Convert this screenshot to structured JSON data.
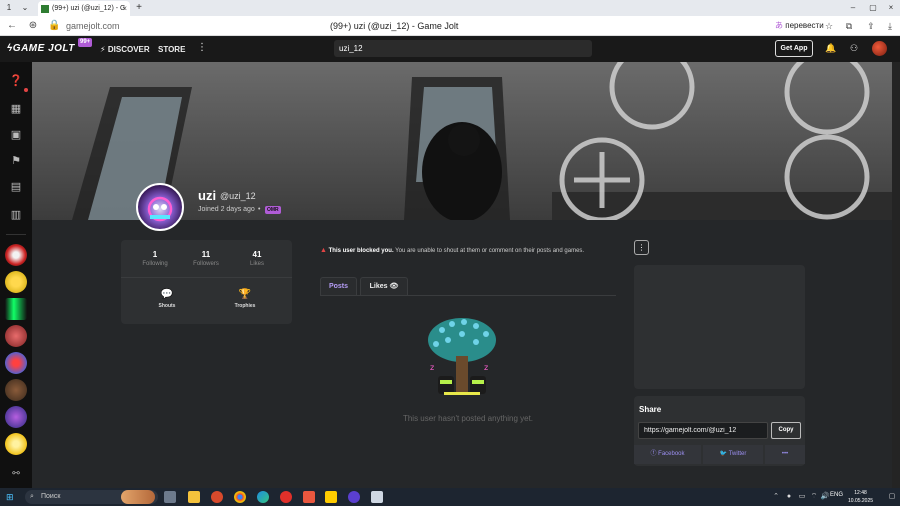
{
  "browser": {
    "tab_count": "1",
    "tab_title": "(99+) uzi (@uzi_12) - G",
    "url": "gamejolt.com",
    "page_title": "(99+) uzi (@uzi_12) - Game Jolt",
    "translate_label": "перевести"
  },
  "topbar": {
    "logo": "GAME JOLT",
    "badge": "99+",
    "discover": "DISCOVER",
    "store": "STORE",
    "search_value": "uzi_12",
    "get_app": "Get App"
  },
  "profile": {
    "name": "uzi",
    "handle": "@uzi_12",
    "joined": "Joined 2 days ago",
    "dot": "•",
    "badge": "OMR"
  },
  "stats": {
    "following_count": "1",
    "following_label": "Following",
    "followers_count": "11",
    "followers_label": "Followers",
    "likes_count": "41",
    "likes_label": "Likes"
  },
  "actions": {
    "shouts": "Shouts",
    "trophies": "Trophies"
  },
  "blocked": {
    "strong": "This user blocked you.",
    "text": " You are unable to shout at them or comment on their posts and games."
  },
  "tabs": {
    "posts": "Posts",
    "likes": "Likes"
  },
  "empty_message": "This user hasn't posted anything yet.",
  "share": {
    "title": "Share",
    "url": "https://gamejolt.com/@uzi_12",
    "copy": "Copy",
    "facebook": "Facebook",
    "twitter": "Twitter",
    "more": "•••"
  },
  "taskbar": {
    "search": "Поиск",
    "lang": "ENG",
    "time": "12:48",
    "date": "10.05.2025"
  },
  "colors": {
    "accent": "#b05cd6",
    "link": "#9b8ff0",
    "warning": "#e24444"
  }
}
